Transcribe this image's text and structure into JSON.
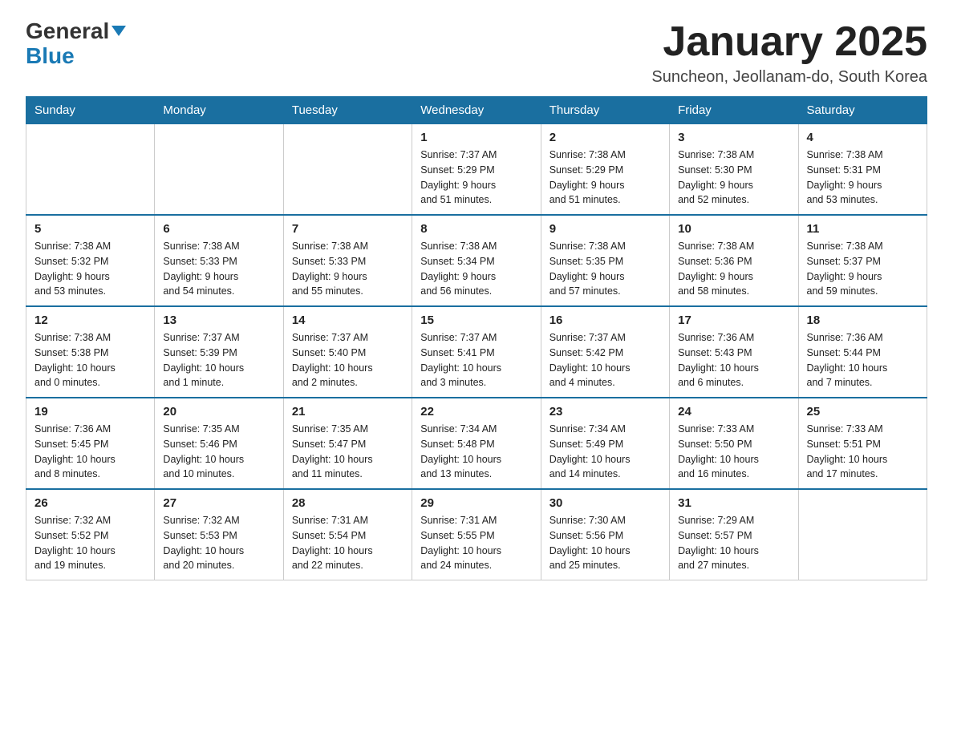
{
  "logo": {
    "text1": "General",
    "text2": "Blue"
  },
  "title": "January 2025",
  "subtitle": "Suncheon, Jeollanam-do, South Korea",
  "days_of_week": [
    "Sunday",
    "Monday",
    "Tuesday",
    "Wednesday",
    "Thursday",
    "Friday",
    "Saturday"
  ],
  "weeks": [
    [
      {
        "day": "",
        "info": ""
      },
      {
        "day": "",
        "info": ""
      },
      {
        "day": "",
        "info": ""
      },
      {
        "day": "1",
        "info": "Sunrise: 7:37 AM\nSunset: 5:29 PM\nDaylight: 9 hours\nand 51 minutes."
      },
      {
        "day": "2",
        "info": "Sunrise: 7:38 AM\nSunset: 5:29 PM\nDaylight: 9 hours\nand 51 minutes."
      },
      {
        "day": "3",
        "info": "Sunrise: 7:38 AM\nSunset: 5:30 PM\nDaylight: 9 hours\nand 52 minutes."
      },
      {
        "day": "4",
        "info": "Sunrise: 7:38 AM\nSunset: 5:31 PM\nDaylight: 9 hours\nand 53 minutes."
      }
    ],
    [
      {
        "day": "5",
        "info": "Sunrise: 7:38 AM\nSunset: 5:32 PM\nDaylight: 9 hours\nand 53 minutes."
      },
      {
        "day": "6",
        "info": "Sunrise: 7:38 AM\nSunset: 5:33 PM\nDaylight: 9 hours\nand 54 minutes."
      },
      {
        "day": "7",
        "info": "Sunrise: 7:38 AM\nSunset: 5:33 PM\nDaylight: 9 hours\nand 55 minutes."
      },
      {
        "day": "8",
        "info": "Sunrise: 7:38 AM\nSunset: 5:34 PM\nDaylight: 9 hours\nand 56 minutes."
      },
      {
        "day": "9",
        "info": "Sunrise: 7:38 AM\nSunset: 5:35 PM\nDaylight: 9 hours\nand 57 minutes."
      },
      {
        "day": "10",
        "info": "Sunrise: 7:38 AM\nSunset: 5:36 PM\nDaylight: 9 hours\nand 58 minutes."
      },
      {
        "day": "11",
        "info": "Sunrise: 7:38 AM\nSunset: 5:37 PM\nDaylight: 9 hours\nand 59 minutes."
      }
    ],
    [
      {
        "day": "12",
        "info": "Sunrise: 7:38 AM\nSunset: 5:38 PM\nDaylight: 10 hours\nand 0 minutes."
      },
      {
        "day": "13",
        "info": "Sunrise: 7:37 AM\nSunset: 5:39 PM\nDaylight: 10 hours\nand 1 minute."
      },
      {
        "day": "14",
        "info": "Sunrise: 7:37 AM\nSunset: 5:40 PM\nDaylight: 10 hours\nand 2 minutes."
      },
      {
        "day": "15",
        "info": "Sunrise: 7:37 AM\nSunset: 5:41 PM\nDaylight: 10 hours\nand 3 minutes."
      },
      {
        "day": "16",
        "info": "Sunrise: 7:37 AM\nSunset: 5:42 PM\nDaylight: 10 hours\nand 4 minutes."
      },
      {
        "day": "17",
        "info": "Sunrise: 7:36 AM\nSunset: 5:43 PM\nDaylight: 10 hours\nand 6 minutes."
      },
      {
        "day": "18",
        "info": "Sunrise: 7:36 AM\nSunset: 5:44 PM\nDaylight: 10 hours\nand 7 minutes."
      }
    ],
    [
      {
        "day": "19",
        "info": "Sunrise: 7:36 AM\nSunset: 5:45 PM\nDaylight: 10 hours\nand 8 minutes."
      },
      {
        "day": "20",
        "info": "Sunrise: 7:35 AM\nSunset: 5:46 PM\nDaylight: 10 hours\nand 10 minutes."
      },
      {
        "day": "21",
        "info": "Sunrise: 7:35 AM\nSunset: 5:47 PM\nDaylight: 10 hours\nand 11 minutes."
      },
      {
        "day": "22",
        "info": "Sunrise: 7:34 AM\nSunset: 5:48 PM\nDaylight: 10 hours\nand 13 minutes."
      },
      {
        "day": "23",
        "info": "Sunrise: 7:34 AM\nSunset: 5:49 PM\nDaylight: 10 hours\nand 14 minutes."
      },
      {
        "day": "24",
        "info": "Sunrise: 7:33 AM\nSunset: 5:50 PM\nDaylight: 10 hours\nand 16 minutes."
      },
      {
        "day": "25",
        "info": "Sunrise: 7:33 AM\nSunset: 5:51 PM\nDaylight: 10 hours\nand 17 minutes."
      }
    ],
    [
      {
        "day": "26",
        "info": "Sunrise: 7:32 AM\nSunset: 5:52 PM\nDaylight: 10 hours\nand 19 minutes."
      },
      {
        "day": "27",
        "info": "Sunrise: 7:32 AM\nSunset: 5:53 PM\nDaylight: 10 hours\nand 20 minutes."
      },
      {
        "day": "28",
        "info": "Sunrise: 7:31 AM\nSunset: 5:54 PM\nDaylight: 10 hours\nand 22 minutes."
      },
      {
        "day": "29",
        "info": "Sunrise: 7:31 AM\nSunset: 5:55 PM\nDaylight: 10 hours\nand 24 minutes."
      },
      {
        "day": "30",
        "info": "Sunrise: 7:30 AM\nSunset: 5:56 PM\nDaylight: 10 hours\nand 25 minutes."
      },
      {
        "day": "31",
        "info": "Sunrise: 7:29 AM\nSunset: 5:57 PM\nDaylight: 10 hours\nand 27 minutes."
      },
      {
        "day": "",
        "info": ""
      }
    ]
  ]
}
